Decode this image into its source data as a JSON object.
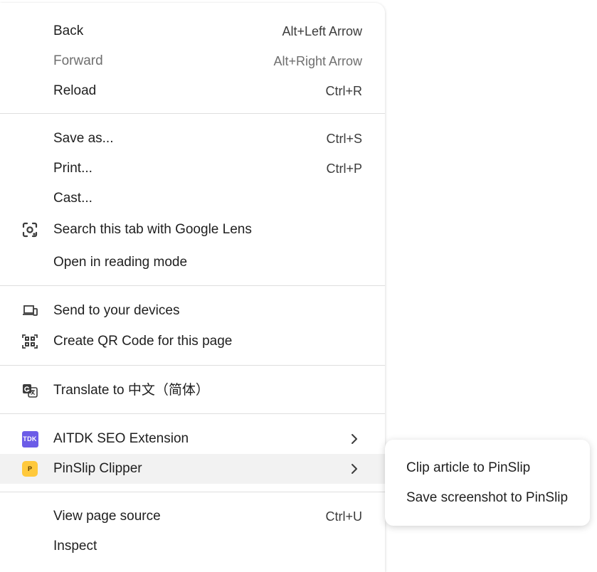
{
  "menu": {
    "items": [
      {
        "label": "Back",
        "shortcut": "Alt+Left Arrow"
      },
      {
        "label": "Forward",
        "shortcut": "Alt+Right Arrow"
      },
      {
        "label": "Reload",
        "shortcut": "Ctrl+R"
      },
      {
        "label": "Save as...",
        "shortcut": "Ctrl+S"
      },
      {
        "label": "Print...",
        "shortcut": "Ctrl+P"
      },
      {
        "label": "Cast..."
      },
      {
        "label": "Search this tab with Google Lens",
        "icon": "google-lens-icon"
      },
      {
        "label": "Open in reading mode"
      },
      {
        "label": "Send to your devices",
        "icon": "devices-icon"
      },
      {
        "label": "Create QR Code for this page",
        "icon": "qr-code-icon"
      },
      {
        "label": "Translate to 中文（简体）",
        "icon": "translate-icon"
      },
      {
        "label": "AITDK SEO Extension",
        "icon": "aitdk-extension-icon",
        "icon_text": "TDK"
      },
      {
        "label": "PinSlip Clipper",
        "icon": "pinslip-extension-icon",
        "icon_text": "P"
      },
      {
        "label": "View page source",
        "shortcut": "Ctrl+U"
      },
      {
        "label": "Inspect"
      }
    ]
  },
  "submenu": {
    "items": [
      {
        "label": "Clip article to PinSlip"
      },
      {
        "label": "Save screenshot to PinSlip"
      }
    ]
  },
  "colors": {
    "aitdk_badge": "#6c5ce7",
    "pinslip_badge": "#ffc93c",
    "hover_bg": "#f2f2f2"
  }
}
